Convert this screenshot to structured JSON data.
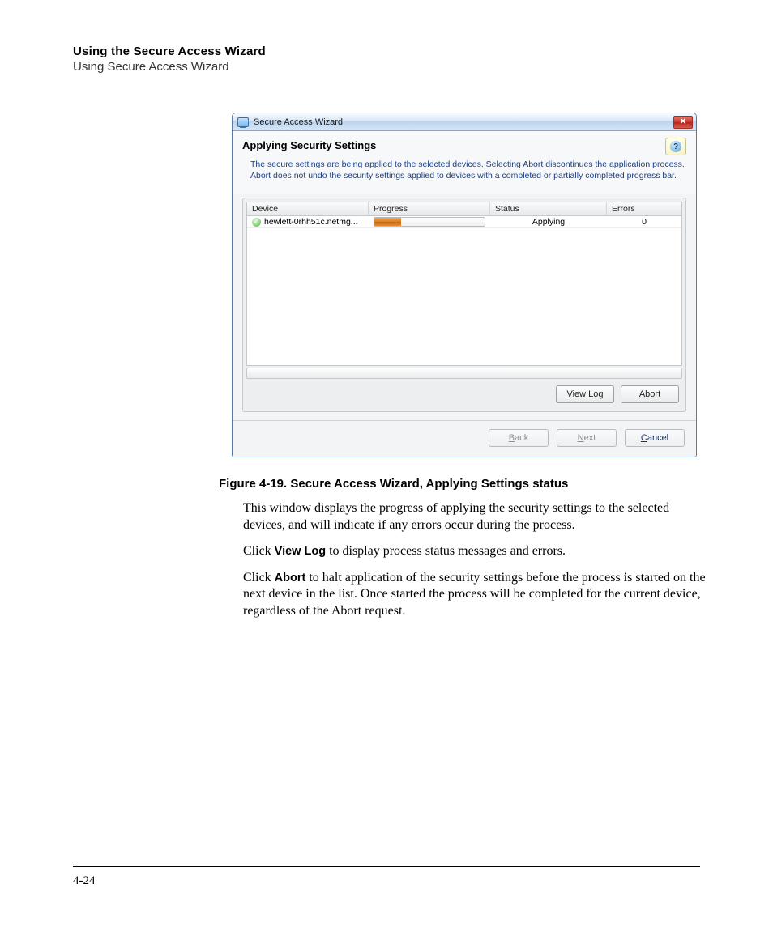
{
  "header": {
    "bold": "Using the Secure Access Wizard",
    "light": "Using Secure Access Wizard"
  },
  "dialog": {
    "title": "Secure Access Wizard",
    "heading": "Applying Security Settings",
    "description": "The secure settings are being applied to the selected devices. Selecting Abort discontinues the application process. Abort does not undo the security settings applied to devices with a completed or partially completed progress bar.",
    "columns": {
      "device": "Device",
      "progress": "Progress",
      "status": "Status",
      "errors": "Errors"
    },
    "rows": [
      {
        "device": "hewlett-0rhh51c.netmg...",
        "progress_pct": 24,
        "status": "Applying",
        "errors": "0"
      }
    ],
    "buttons": {
      "view_log": "View Log",
      "abort": "Abort",
      "back": "Back",
      "next": "Next",
      "cancel": "Cancel"
    }
  },
  "caption": "Figure 4-19. Secure Access Wizard, Applying Settings status",
  "body": {
    "p1": "This window displays the progress of applying the security settings to the selected devices, and will indicate if any errors occur during the process.",
    "p2_pre": "Click ",
    "p2_b": "View Log",
    "p2_post": " to display process status messages and errors.",
    "p3_pre": "Click ",
    "p3_b": "Abort",
    "p3_post": " to halt application of the security settings before the process is started on the next device in the list. Once started the process will be completed for the current device, regardless of the Abort request."
  },
  "page_number": "4-24"
}
